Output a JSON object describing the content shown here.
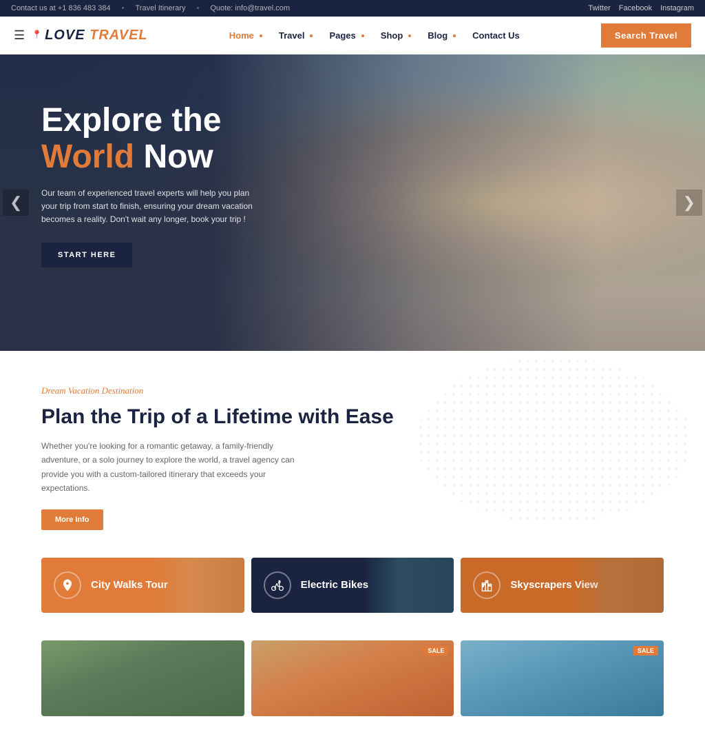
{
  "topbar": {
    "contact": "Contact us at +1 836 483 384",
    "itinerary": "Travel Itinerary",
    "quote": "Quote: info@travel.com",
    "social": [
      "Twitter",
      "Facebook",
      "Instagram"
    ]
  },
  "header": {
    "logo": "LOVE TRAVEL",
    "logo_highlight": "TRAVEL",
    "nav_items": [
      {
        "label": "Home",
        "active": true
      },
      {
        "label": "Travel",
        "active": false
      },
      {
        "label": "Pages",
        "active": false
      },
      {
        "label": "Shop",
        "active": false
      },
      {
        "label": "Blog",
        "active": false
      },
      {
        "label": "Contact Us",
        "active": false
      }
    ],
    "search_btn": "Search Travel"
  },
  "hero": {
    "title_line1": "Explore the",
    "title_line2": "World",
    "title_line3": "Now",
    "highlight_word": "World",
    "description": "Our team of experienced travel experts will help you plan your trip from start to finish, ensuring your dream vacation becomes a reality. Don't wait any longer, book your trip !",
    "cta_label": "START HERE",
    "arrow_left": "❮",
    "arrow_right": "❯"
  },
  "plan": {
    "subtitle": "Dream Vacation Destination",
    "title": "Plan the Trip of a Lifetime with Ease",
    "description": "Whether you're looking for a romantic getaway, a family-friendly adventure, or a solo journey to explore the world, a travel agency can provide you with a custom-tailored itinerary that exceeds your expectations.",
    "cta_label": "More Info"
  },
  "tour_cards": [
    {
      "label": "City Walks Tour",
      "icon": "pin",
      "theme": "orange"
    },
    {
      "label": "Electric Bikes",
      "icon": "bike",
      "theme": "dark-blue"
    },
    {
      "label": "Skyscrapers View",
      "icon": "building",
      "theme": "orange2"
    }
  ],
  "bottom_photos": [
    {
      "sale": false
    },
    {
      "sale": true
    },
    {
      "sale": true
    }
  ]
}
